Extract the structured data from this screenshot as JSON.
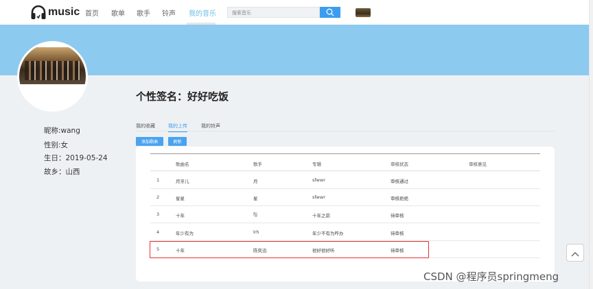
{
  "nav": {
    "logo_text": "music",
    "items": [
      "首页",
      "歌单",
      "歌手",
      "铃声",
      "我的音乐"
    ],
    "active_index": 4,
    "search_placeholder": "搜索音乐"
  },
  "profile": {
    "nickname": "昵称:wang",
    "gender": "性别:女",
    "birthday": "生日：2019-05-24",
    "hometown": "故乡：山西",
    "signature": "个性签名：好好吃饭"
  },
  "tabs": [
    "我的收藏",
    "我的上传",
    "我的铃声"
  ],
  "active_tab": 1,
  "buttons": {
    "add": "添加歌曲",
    "refresh": "刷新"
  },
  "table": {
    "headers": [
      "",
      "歌曲名",
      "歌手",
      "专辑",
      "审核状态",
      "审核意见"
    ],
    "rows": [
      [
        "1",
        "月牙儿",
        "月",
        "sfwwr",
        "审核通过",
        ""
      ],
      [
        "2",
        "星星",
        "星",
        "sfwwr",
        "审核拒绝",
        ""
      ],
      [
        "3",
        "十年",
        "fjj",
        "十年之前",
        "待审核",
        ""
      ],
      [
        "4",
        "年少有为",
        "lrh",
        "年少不有为咋办",
        "待审核",
        ""
      ],
      [
        "5",
        "十年",
        "陈奕迅",
        "很好很好听",
        "待审核",
        ""
      ]
    ],
    "highlighted_row": 5
  },
  "colors": {
    "accent": "#3b9cf0",
    "banner": "#8dcaf0",
    "highlight_border": "#e53030"
  },
  "watermark": "CSDN @程序员springmeng"
}
